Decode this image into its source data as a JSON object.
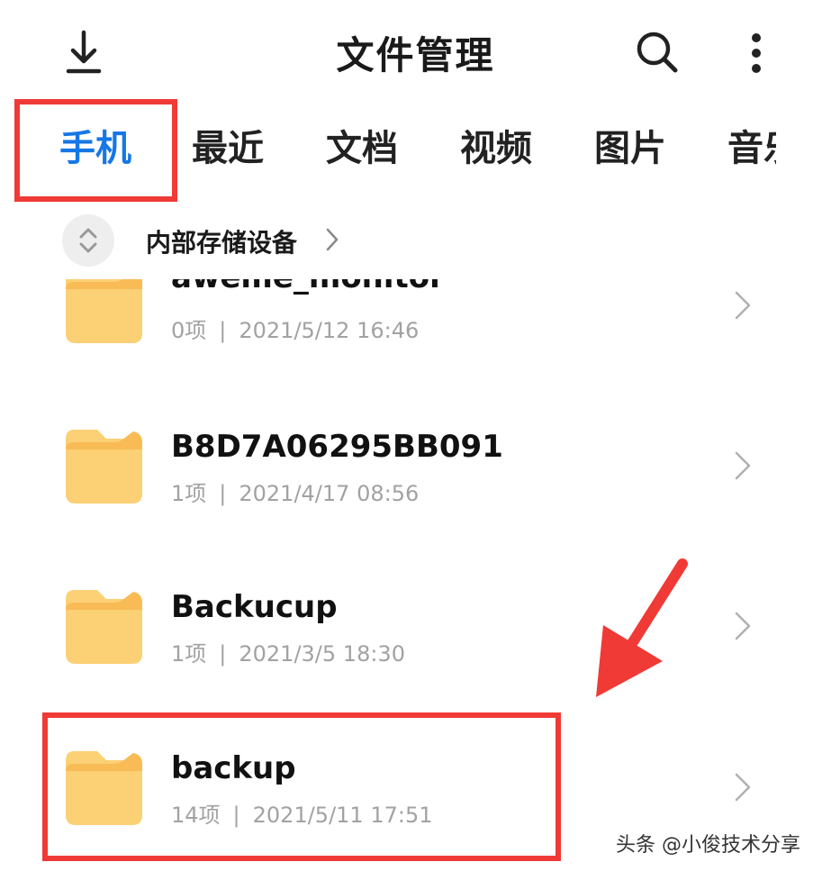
{
  "header": {
    "title": "文件管理",
    "download_icon": "download-icon",
    "search_icon": "search-icon",
    "more_icon": "more-vertical-icon"
  },
  "tabs": [
    {
      "label": "手机",
      "active": true
    },
    {
      "label": "最近",
      "active": false
    },
    {
      "label": "文档",
      "active": false
    },
    {
      "label": "视频",
      "active": false
    },
    {
      "label": "图片",
      "active": false
    },
    {
      "label": "音乐",
      "active": false
    }
  ],
  "location": {
    "label": "内部存储设备",
    "toggle_icon": "expand-collapse-icon",
    "chevron_icon": "chevron-right-icon"
  },
  "files": [
    {
      "name": "aweme_monitor",
      "count": "0项",
      "date": "2021/5/12 16:46"
    },
    {
      "name": "B8D7A06295BB091",
      "count": "1项",
      "date": "2021/4/17 08:56"
    },
    {
      "name": "Backucup",
      "count": "1项",
      "date": "2021/3/5 18:30"
    },
    {
      "name": "backup",
      "count": "14项",
      "date": "2021/5/11 17:51"
    }
  ],
  "colors": {
    "accent": "#1677e6",
    "annotation_red": "#f03a36",
    "folder_yellow": "#fcd075",
    "meta_gray": "#a2a2a2"
  },
  "watermark": "头条 @小俊技术分享"
}
